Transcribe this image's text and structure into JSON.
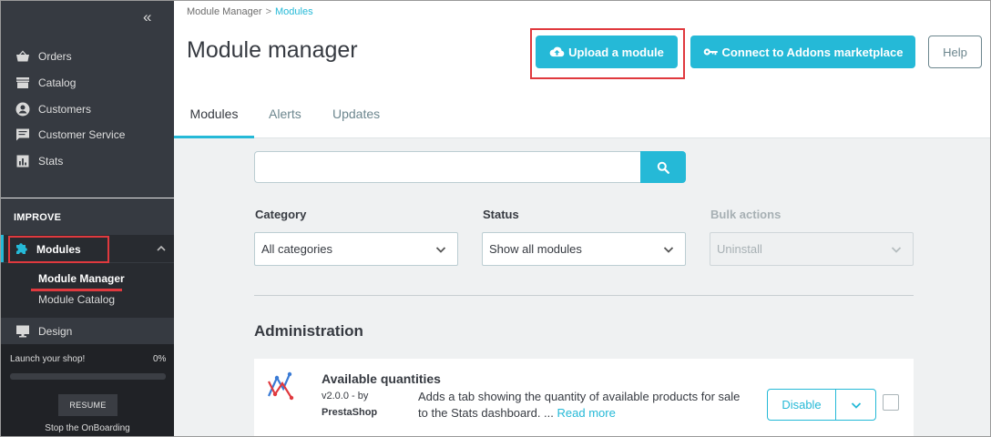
{
  "sidebar": {
    "items": [
      {
        "label": "Orders",
        "icon": "basket-icon"
      },
      {
        "label": "Catalog",
        "icon": "store-icon"
      },
      {
        "label": "Customers",
        "icon": "account-icon"
      },
      {
        "label": "Customer Service",
        "icon": "chat-icon"
      },
      {
        "label": "Stats",
        "icon": "bar-chart-icon"
      }
    ],
    "section_label": "IMPROVE",
    "modules_label": "Modules",
    "submenu": [
      "Module Manager",
      "Module Catalog"
    ],
    "design_label": "Design",
    "onboarding": {
      "launch_label": "Launch your shop!",
      "percent": "0%",
      "progress": 0,
      "resume_label": "RESUME",
      "stop_label": "Stop the OnBoarding"
    }
  },
  "breadcrumb": {
    "parent": "Module Manager",
    "current": "Modules"
  },
  "header": {
    "title": "Module manager",
    "upload_label": "Upload a module",
    "addons_label": "Connect to Addons marketplace",
    "help_label": "Help"
  },
  "tabs": [
    "Modules",
    "Alerts",
    "Updates"
  ],
  "filters": {
    "search_value": "",
    "category_label": "Category",
    "category_value": "All categories",
    "status_label": "Status",
    "status_value": "Show all modules",
    "bulk_label": "Bulk actions",
    "bulk_value": "Uninstall"
  },
  "section_title": "Administration",
  "module": {
    "name": "Available quantities",
    "version": "v2.0.0 - by",
    "author": "PrestaShop",
    "description": "Adds a tab showing the quantity of available products for sale to the Stats dashboard. ...",
    "read_more": "Read more",
    "disable_label": "Disable"
  },
  "colors": {
    "accent": "#25b9d7",
    "highlight": "#e0393e",
    "sidebar": "#363a41"
  }
}
